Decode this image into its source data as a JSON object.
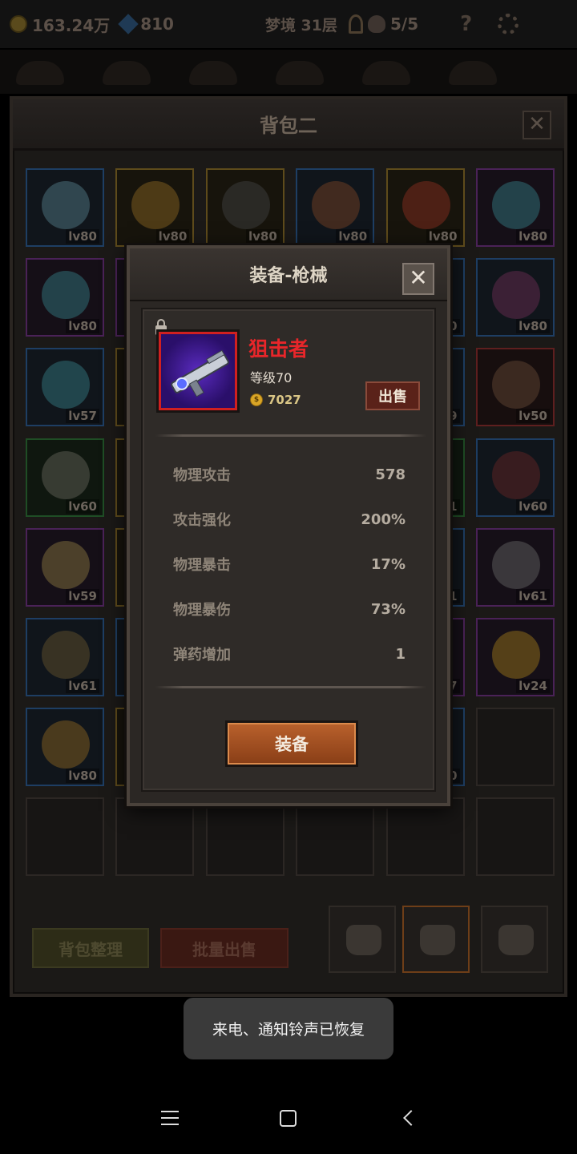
{
  "topbar": {
    "gold": "163.24万",
    "gems": "810",
    "floor": "梦境 31层",
    "keys_count": "5/5",
    "help": "?"
  },
  "bag": {
    "title": "背包二",
    "close": "✕",
    "slots": [
      {
        "lv": "lv80",
        "rarity": "blue",
        "art": "#4a6f7a"
      },
      {
        "lv": "lv80",
        "rarity": "gold",
        "art": "#7a5a1f"
      },
      {
        "lv": "lv80",
        "rarity": "gold",
        "art": "#3a3a3a"
      },
      {
        "lv": "lv80",
        "rarity": "blue",
        "art": "#6a3d22"
      },
      {
        "lv": "lv80",
        "rarity": "gold",
        "art": "#7a2a1e"
      },
      {
        "lv": "lv80",
        "rarity": "purple",
        "art": "#2f6e74"
      },
      {
        "lv": "lv80",
        "rarity": "purple",
        "art": "#2f6e74"
      },
      {
        "lv": "",
        "rarity": "purple",
        "art": ""
      },
      {
        "lv": "",
        "rarity": "blue",
        "art": ""
      },
      {
        "lv": "",
        "rarity": "blue",
        "art": ""
      },
      {
        "lv": "0",
        "rarity": "blue",
        "art": ""
      },
      {
        "lv": "lv80",
        "rarity": "blue",
        "art": "#5e2a4a"
      },
      {
        "lv": "lv57",
        "rarity": "blue",
        "art": "#2f6e74"
      },
      {
        "lv": "",
        "rarity": "gold",
        "art": ""
      },
      {
        "lv": "",
        "rarity": "gold",
        "art": ""
      },
      {
        "lv": "",
        "rarity": "gold",
        "art": ""
      },
      {
        "lv": "9",
        "rarity": "blue",
        "art": ""
      },
      {
        "lv": "lv50",
        "rarity": "red",
        "art": "#5a4030"
      },
      {
        "lv": "lv60",
        "rarity": "green",
        "art": "#5a5a50"
      },
      {
        "lv": "",
        "rarity": "gold",
        "art": ""
      },
      {
        "lv": "",
        "rarity": "gold",
        "art": ""
      },
      {
        "lv": "",
        "rarity": "gold",
        "art": ""
      },
      {
        "lv": "1",
        "rarity": "green",
        "art": ""
      },
      {
        "lv": "lv60",
        "rarity": "blue",
        "art": "#5a2222"
      },
      {
        "lv": "lv59",
        "rarity": "purple",
        "art": "#7a6a3a"
      },
      {
        "lv": "",
        "rarity": "gold",
        "art": ""
      },
      {
        "lv": "",
        "rarity": "gold",
        "art": ""
      },
      {
        "lv": "",
        "rarity": "gold",
        "art": ""
      },
      {
        "lv": "1",
        "rarity": "blue",
        "art": ""
      },
      {
        "lv": "lv61",
        "rarity": "purple",
        "art": "#5a5a5a"
      },
      {
        "lv": "lv61",
        "rarity": "blue",
        "art": "#5a4a2a"
      },
      {
        "lv": "",
        "rarity": "blue",
        "art": ""
      },
      {
        "lv": "",
        "rarity": "blue",
        "art": ""
      },
      {
        "lv": "",
        "rarity": "blue",
        "art": ""
      },
      {
        "lv": "7",
        "rarity": "purple",
        "art": ""
      },
      {
        "lv": "lv24",
        "rarity": "purple",
        "art": "#8a6a1a"
      },
      {
        "lv": "lv80",
        "rarity": "blue",
        "art": "#7a5a1f"
      },
      {
        "lv": "",
        "rarity": "gold",
        "art": ""
      },
      {
        "lv": "",
        "rarity": "gold",
        "art": ""
      },
      {
        "lv": "",
        "rarity": "gold",
        "art": ""
      },
      {
        "lv": "0",
        "rarity": "blue",
        "art": ""
      },
      {
        "lv": "",
        "rarity": "empty",
        "art": ""
      },
      {
        "lv": "",
        "rarity": "empty",
        "art": ""
      },
      {
        "lv": "",
        "rarity": "empty",
        "art": ""
      },
      {
        "lv": "",
        "rarity": "empty",
        "art": ""
      },
      {
        "lv": "",
        "rarity": "empty",
        "art": ""
      },
      {
        "lv": "",
        "rarity": "empty",
        "art": ""
      },
      {
        "lv": "",
        "rarity": "empty",
        "art": ""
      }
    ],
    "sort_label": "背包整理",
    "bulk_sell_label": "批量出售"
  },
  "modal": {
    "title": "装备-枪械",
    "close": "✕",
    "item_name": "狙击者",
    "level": "等级70",
    "gold_value": "7027",
    "coin_symbol": "$",
    "sell_label": "出售",
    "stats": [
      {
        "name": "物理攻击",
        "value": "578"
      },
      {
        "name": "攻击强化",
        "value": "200%"
      },
      {
        "name": "物理暴击",
        "value": "17%"
      },
      {
        "name": "物理暴伤",
        "value": "73%"
      },
      {
        "name": "弹药增加",
        "value": "1"
      }
    ],
    "equip_label": "装备"
  },
  "toast": "来电、通知铃声已恢复"
}
